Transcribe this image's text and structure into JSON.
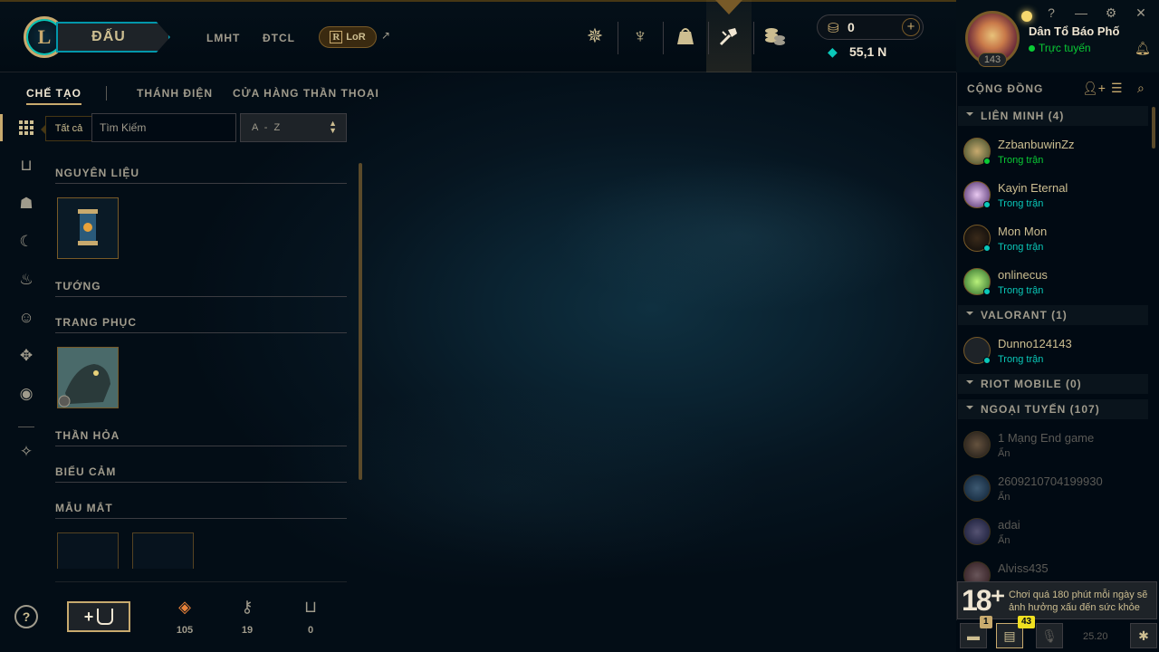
{
  "nav": {
    "play_label": "ĐẤU",
    "links": [
      "LMHT",
      "ĐTCL"
    ],
    "lor_label": "LoR",
    "lor_ext": "↗",
    "icons": [
      "profile-icon",
      "ranked-icon",
      "collection-icon",
      "loot-icon",
      "store-icon"
    ],
    "rp_value": "0",
    "be_value": "55,1 N",
    "rp_add": "+"
  },
  "profile": {
    "name": "Dân Tổ Báo Phố",
    "status": "Trực tuyến",
    "level": "143"
  },
  "window_controls": [
    "?",
    "—",
    "⚙",
    "✕"
  ],
  "tabs": [
    "CHẾ TẠO",
    "THÁNH ĐIỆN",
    "CỬA HÀNG THẦN THOẠI"
  ],
  "tooltip": "Tất cả",
  "search_placeholder": "Tìm Kiếm",
  "sort_value": "A - Z",
  "sections": [
    "NGUYÊN LIỆU",
    "TƯỚNG",
    "TRANG PHỤC",
    "THẦN HỎA",
    "BIỂU CẢM",
    "MẪU MẮT"
  ],
  "resources": [
    {
      "icon": "orange-essence-icon",
      "value": "105"
    },
    {
      "icon": "key-icon",
      "value": "19"
    },
    {
      "icon": "chest-icon",
      "value": "0"
    }
  ],
  "help": "?",
  "craft_plus": "+",
  "social": {
    "title": "CỘNG ĐỒNG",
    "groups": [
      {
        "label": "LIÊN MINH (4)"
      },
      {
        "label": "VALORANT (1)"
      },
      {
        "label": "RIOT MOBILE (0)"
      },
      {
        "label": "NGOẠI TUYẾN (107)"
      }
    ],
    "friends": [
      {
        "name": "ZzbanbuwinZz",
        "status": "Trong trận"
      },
      {
        "name": "Kayin Eternal",
        "status": "Trong trận"
      },
      {
        "name": "Mon Mon",
        "status": "Trong trận"
      },
      {
        "name": "onlinecus",
        "status": "Trong trận"
      },
      {
        "name": "Dunno124143",
        "status": "Trong trận"
      },
      {
        "name": "1 Mạng End game",
        "status": "Ẩn"
      },
      {
        "name": "2609210704199930",
        "status": "Ẩn"
      },
      {
        "name": "adai",
        "status": "Ẩn"
      },
      {
        "name": "Alviss435",
        "status": ""
      }
    ],
    "warning_age": "18⁺",
    "warning_text": "Chơi quá 180 phút mỗi ngày sẽ ảnh hưởng xấu đến sức khỏe",
    "chat_badge": "1",
    "mission_badge": "43",
    "version": "25.20"
  },
  "colors": {
    "gold": "#c8aa6e",
    "teal": "#0ac8b9",
    "online": "#0acb35",
    "ingame": "#0ac8b9"
  }
}
